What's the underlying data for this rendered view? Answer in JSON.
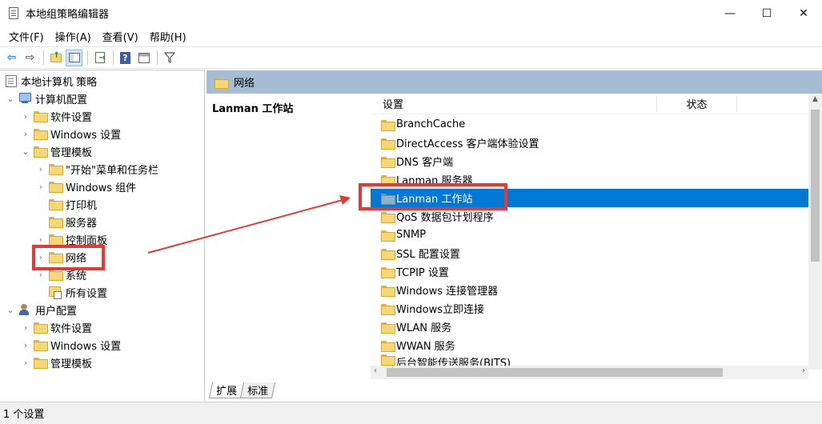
{
  "window": {
    "title": "本地组策略编辑器",
    "controls": [
      "—",
      "☐",
      "✕"
    ]
  },
  "menu": [
    "文件(F)",
    "操作(A)",
    "查看(V)",
    "帮助(H)"
  ],
  "toolbar": {
    "icons": [
      "back-arrow-icon",
      "forward-arrow-icon",
      "up-folder-icon",
      "show-hide-tree-icon",
      "export-list-icon",
      "help-icon",
      "properties-view-icon",
      "filter-icon"
    ]
  },
  "tree": {
    "root": "本地计算机 策略",
    "computer_config": "计算机配置",
    "software_settings": "软件设置",
    "windows_settings": "Windows 设置",
    "admin_templates": "管理模板",
    "start_menu": "\"开始\"菜单和任务栏",
    "windows_components": "Windows 组件",
    "printers": "打印机",
    "server": "服务器",
    "control_panel": "控制面板",
    "network": "网络",
    "system": "系统",
    "all_settings": "所有设置",
    "user_config": "用户配置",
    "user_software_settings": "软件设置",
    "user_windows_settings": "Windows 设置",
    "user_admin_templates": "管理模板"
  },
  "right": {
    "header": "网络",
    "description_title": "Lanman 工作站",
    "columns": {
      "setting": "设置",
      "state": "状态"
    },
    "items": [
      "BranchCache",
      "DirectAccess 客户端体验设置",
      "DNS 客户端",
      "Lanman 服务器",
      "Lanman 工作站",
      "QoS 数据包计划程序",
      "SNMP",
      "SSL 配置设置",
      "TCPIP 设置",
      "Windows 连接管理器",
      "Windows立即连接",
      "WLAN 服务",
      "WWAN 服务",
      "后台智能传送服务(BITS)"
    ],
    "selected_index": 4,
    "tabs": [
      "扩展",
      "标准"
    ]
  },
  "status": {
    "text": "1 个设置"
  },
  "colors": {
    "selection": "#0078d7",
    "annotation": "#e53935",
    "header_band": "#a5bcd3"
  }
}
